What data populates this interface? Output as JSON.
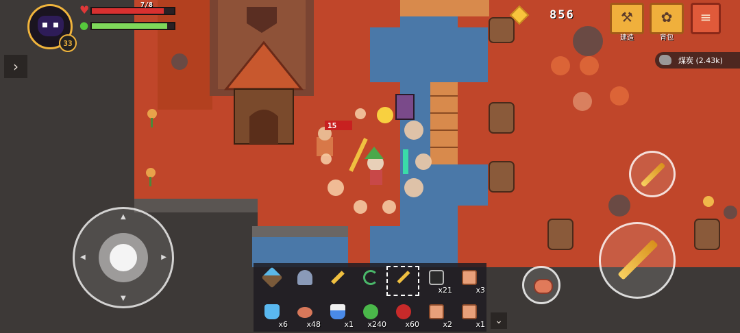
{
  "hud": {
    "level": "33",
    "hp_text": "7/8",
    "hp_fraction": 0.875,
    "energy_fraction": 0.92,
    "gem_count": "856",
    "resource_label": "煤炭 (2.43k)",
    "enemy_damage_text": "15"
  },
  "buttons": {
    "build_label": "建造",
    "bag_label": "背包"
  },
  "hotbar": {
    "row1": [
      {
        "name": "pickaxe",
        "count": ""
      },
      {
        "name": "shovel",
        "count": ""
      },
      {
        "name": "golden-sword",
        "count": ""
      },
      {
        "name": "bow",
        "count": ""
      },
      {
        "name": "spear",
        "count": ""
      },
      {
        "name": "jar",
        "count": "x21"
      },
      {
        "name": "scroll",
        "count": "x3"
      }
    ],
    "row2": [
      {
        "name": "blue-potion",
        "count": "x6"
      },
      {
        "name": "meat",
        "count": "x48"
      },
      {
        "name": "flask",
        "count": "x1"
      },
      {
        "name": "cactus-fruit",
        "count": "x240"
      },
      {
        "name": "berries",
        "count": "x60"
      },
      {
        "name": "scroll",
        "count": "x2"
      },
      {
        "name": "scroll",
        "count": "x1"
      }
    ]
  },
  "colors": {
    "ground": "#c0462a",
    "water": "#4a78a8",
    "accent": "#f0b03c"
  }
}
